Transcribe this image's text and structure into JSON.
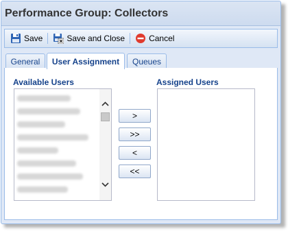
{
  "window": {
    "title": "Performance Group: Collectors"
  },
  "toolbar": {
    "save_label": "Save",
    "save_close_label": "Save and Close",
    "cancel_label": "Cancel"
  },
  "tabs": [
    {
      "label": "General",
      "active": false
    },
    {
      "label": "User Assignment",
      "active": true
    },
    {
      "label": "Queues",
      "active": false
    }
  ],
  "available": {
    "label": "Available Users",
    "items_blurred": true
  },
  "assigned": {
    "label": "Assigned Users"
  },
  "move_buttons": {
    "add": ">",
    "add_all": ">>",
    "remove": "<",
    "remove_all": "<<"
  },
  "colors": {
    "accent": "#15428b",
    "border": "#99bbe8",
    "cancel_red": "#e03b2e",
    "disk_blue": "#2e64b4"
  }
}
